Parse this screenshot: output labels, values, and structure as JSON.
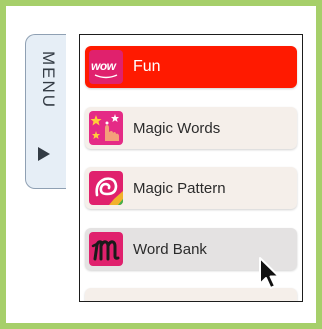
{
  "menu_tab": {
    "label": "MENU"
  },
  "items": [
    {
      "label": "Fun",
      "icon": "wow-logo-icon",
      "icon_text": "wow",
      "state": "active"
    },
    {
      "label": "Magic Words",
      "icon": "magic-hand-icon"
    },
    {
      "label": "Magic Pattern",
      "icon": "swirl-pattern-icon"
    },
    {
      "label": "Word Bank",
      "icon": "word-bank-m-icon",
      "state": "hovered"
    }
  ],
  "colors": {
    "border": "#a6cf6a",
    "active_item": "#ff1a00",
    "item_bg": "#f5efea",
    "hover_item": "#e4e2e2",
    "icon_pink": "#e0216d"
  }
}
